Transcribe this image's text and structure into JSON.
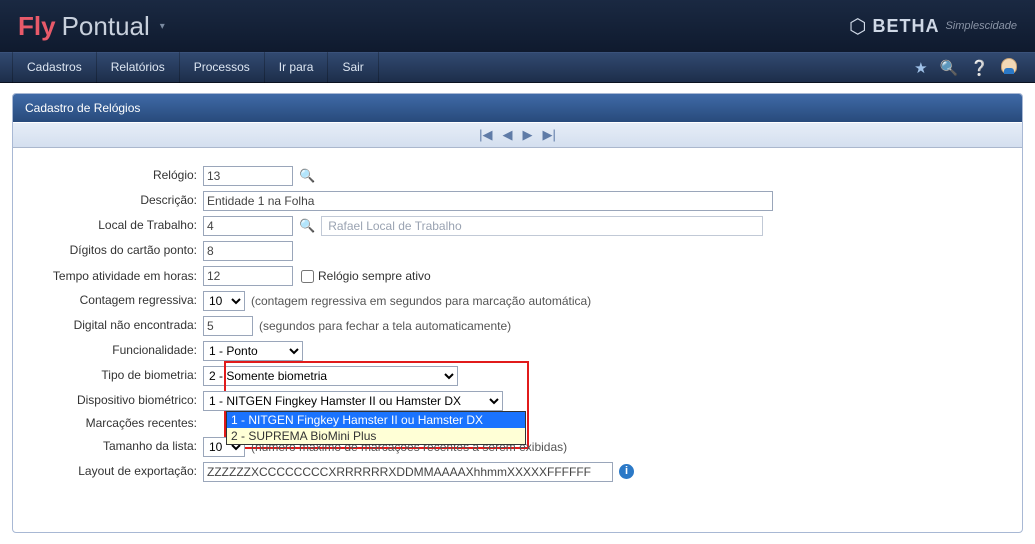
{
  "header": {
    "fly": "Fly",
    "pontual": "Pontual",
    "betha": "BETHA",
    "betha_tag": "Simplescidade"
  },
  "menu": {
    "items": [
      "Cadastros",
      "Relatórios",
      "Processos",
      "Ir para",
      "Sair"
    ]
  },
  "panel": {
    "title": "Cadastro de Relógios"
  },
  "labels": {
    "relogio": "Relógio:",
    "descricao": "Descrição:",
    "local": "Local de Trabalho:",
    "digitos": "Dígitos do cartão ponto:",
    "tempo": "Tempo atividade em horas:",
    "contagem": "Contagem regressiva:",
    "digital": "Digital não encontrada:",
    "funcionalidade": "Funcionalidade:",
    "tipo_bio": "Tipo de biometria:",
    "dispositivo": "Dispositivo biométrico:",
    "marcacoes": "Marcações recentes:",
    "tamanho": "Tamanho da lista:",
    "layout": "Layout de exportação:",
    "sempre_ativo": "Relógio sempre ativo",
    "contagem_hint": "(contagem regressiva em segundos para marcação automática)",
    "digital_hint": "(segundos para fechar a tela automaticamente)",
    "tamanho_hint": "(número máximo de marcações recentes a serem exibidas)"
  },
  "values": {
    "relogio": "13",
    "descricao": "Entidade 1 na Folha",
    "local": "4",
    "local_desc": "Rafael Local de Trabalho",
    "digitos": "8",
    "tempo": "12",
    "contagem": "10",
    "digital": "5",
    "funcionalidade": "1 - Ponto",
    "tipo_bio": "2 - Somente biometria",
    "dispositivo_selected": "1 - NITGEN Fingkey Hamster II ou Hamster DX",
    "dispositivo_options": [
      "1 - NITGEN Fingkey Hamster II ou Hamster DX",
      "2 - SUPREMA BioMini Plus"
    ],
    "tamanho": "10",
    "layout": "ZZZZZZXCCCCCCCCXRRRRRRXDDMMAAAAXhhmmXXXXXFFFFFF"
  }
}
